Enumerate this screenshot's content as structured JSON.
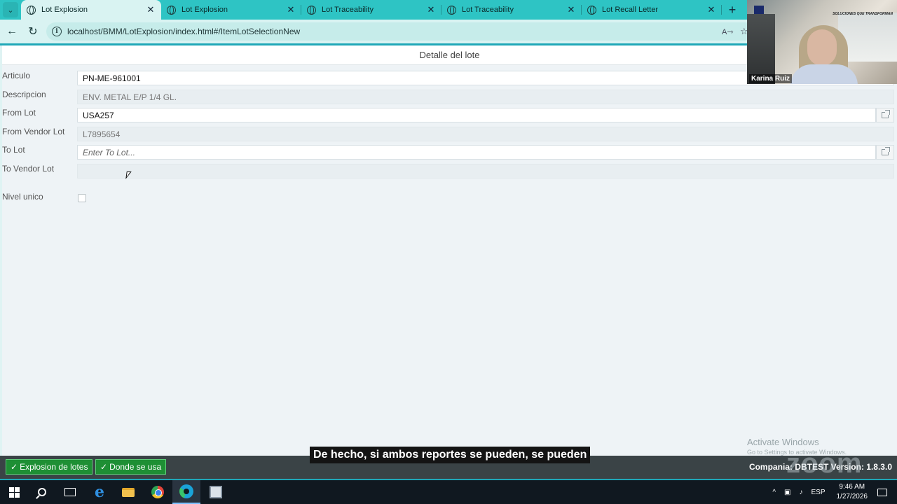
{
  "browser": {
    "tabs": [
      {
        "title": "Lot Explosion",
        "active": true
      },
      {
        "title": "Lot Explosion",
        "active": false
      },
      {
        "title": "Lot Traceability",
        "active": false
      },
      {
        "title": "Lot Traceability",
        "active": false
      },
      {
        "title": "Lot Recall Letter",
        "active": false
      }
    ],
    "url": "localhost/BMM/LotExplosion/index.html#/ItemLotSelectionNew",
    "read_aloud": "Aͅ",
    "accent_color": "#2ec4c4"
  },
  "page": {
    "title": "Detalle del lote",
    "fields": {
      "articulo": {
        "label": "Articulo",
        "value": "PN-ME-961001"
      },
      "descripcion": {
        "label": "Descripcion",
        "value": "ENV. METAL E/P 1/4 GL."
      },
      "from_lot": {
        "label": "From Lot",
        "value": "USA257"
      },
      "from_vendor_lot": {
        "label": "From Vendor Lot",
        "value": "L7895654"
      },
      "to_lot": {
        "label": "To Lot",
        "value": "",
        "placeholder": "Enter To Lot..."
      },
      "to_vendor_lot": {
        "label": "To Vendor Lot",
        "value": ""
      },
      "nivel_unico": {
        "label": "Nivel unico",
        "checked": false
      }
    }
  },
  "footer": {
    "explosion_button": "Explosion de lotes",
    "donde_button": "Donde se usa",
    "company_version": "Compania: DBTEST  Version: 1.8.3.0",
    "green_color": "#1e8f34"
  },
  "overlay": {
    "caption": "De hecho, si ambos reportes se pueden, se pueden",
    "activate_title": "Activate Windows",
    "activate_sub": "Go to Settings to activate Windows.",
    "zoom_watermark": "zoom",
    "video_name": "Karina Ruiz",
    "video_tagline": "SOLUCIONES QUE TRANSFORMAN"
  },
  "taskbar": {
    "language": "ESP",
    "time": "9:46 AM",
    "date": "1/27/2026"
  }
}
